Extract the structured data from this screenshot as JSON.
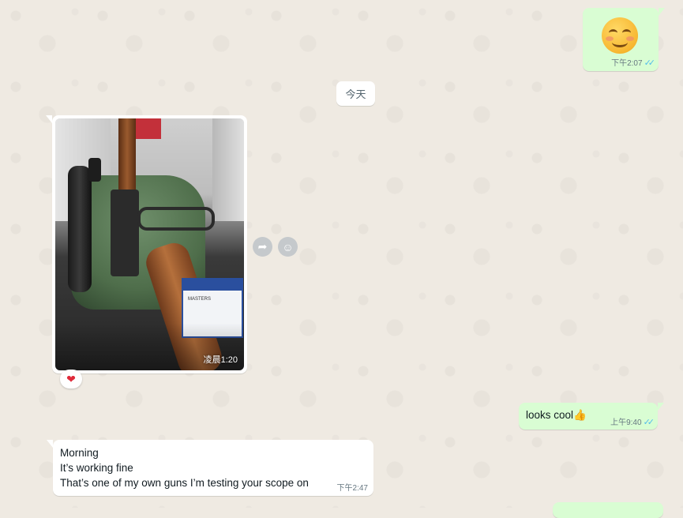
{
  "messages": {
    "emoji": {
      "icon": "smiling-face-with-smiling-eyes",
      "time": "下午2:07",
      "ticks": "✓✓"
    },
    "date_divider": "今天",
    "image": {
      "time": "凌晨1:20",
      "reaction": "❤",
      "ammo_label": "MASTERS"
    },
    "looks_cool": {
      "text": "looks cool👍",
      "time": "上午9:40",
      "ticks": "✓✓"
    },
    "reply": {
      "lines": [
        "Morning",
        "It’s working fine",
        "That’s one of my own guns I’m testing your scope on"
      ],
      "time": "下午2:47"
    }
  },
  "actions": {
    "forward": "➦",
    "emoji": "☺"
  },
  "colors": {
    "outgoing": "#d9fdd3",
    "incoming": "#ffffff",
    "background": "#efeae2",
    "read_ticks": "#53bdeb"
  }
}
